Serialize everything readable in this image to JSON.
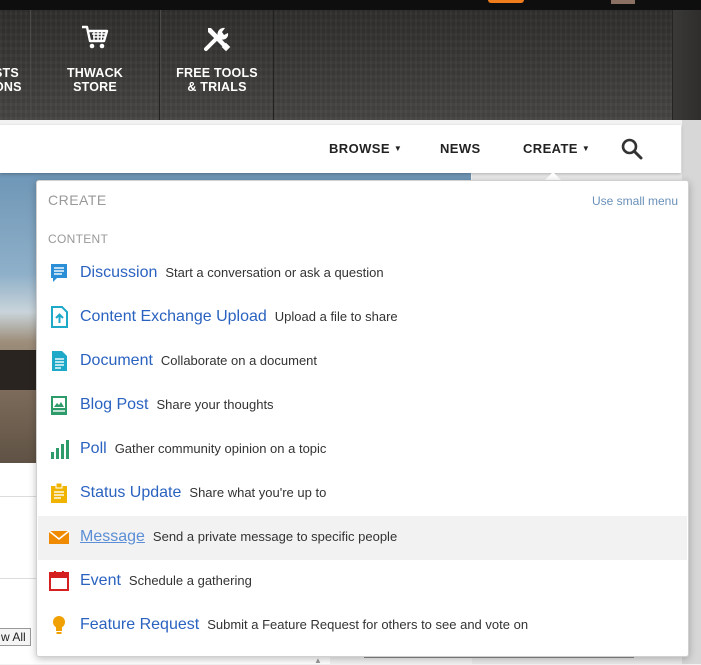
{
  "header": {
    "tiles": [
      {
        "label": "STS\nONS",
        "icon": "partial-icon"
      },
      {
        "label": "THWACK\nSTORE",
        "icon": "cart-icon"
      },
      {
        "label": "FREE TOOLS\n& TRIALS",
        "icon": "tools-icon"
      }
    ]
  },
  "navbar": {
    "browse": "BROWSE",
    "news": "NEWS",
    "create": "CREATE",
    "caret": "▼",
    "search_icon": "search-icon"
  },
  "dropdown": {
    "title": "CREATE",
    "small_menu_link": "Use small menu",
    "section": "CONTENT",
    "items": [
      {
        "name": "Discussion",
        "desc": "Start a conversation or ask a question",
        "icon": "discussion-icon",
        "color": "#2a8fd6"
      },
      {
        "name": "Content Exchange Upload",
        "desc": "Upload a file to share",
        "icon": "upload-icon",
        "color": "#1fa9c9"
      },
      {
        "name": "Document",
        "desc": "Collaborate on a document",
        "icon": "document-icon",
        "color": "#1fa9c9"
      },
      {
        "name": "Blog Post",
        "desc": "Share your thoughts",
        "icon": "blog-icon",
        "color": "#2e9c6a"
      },
      {
        "name": "Poll",
        "desc": "Gather community opinion on a topic",
        "icon": "poll-icon",
        "color": "#2e9c6a"
      },
      {
        "name": "Status Update",
        "desc": "Share what you're up to",
        "icon": "status-icon",
        "color": "#f0b400"
      },
      {
        "name": "Message",
        "desc": "Send a private message to specific people",
        "icon": "envelope-icon",
        "color": "#f08a00"
      },
      {
        "name": "Event",
        "desc": "Schedule a gathering",
        "icon": "calendar-icon",
        "color": "#d42020"
      },
      {
        "name": "Feature Request",
        "desc": "Submit a Feature Request for others to see and vote on",
        "icon": "lightbulb-icon",
        "color": "#f0a000"
      }
    ]
  },
  "page": {
    "view_all": "w All"
  }
}
